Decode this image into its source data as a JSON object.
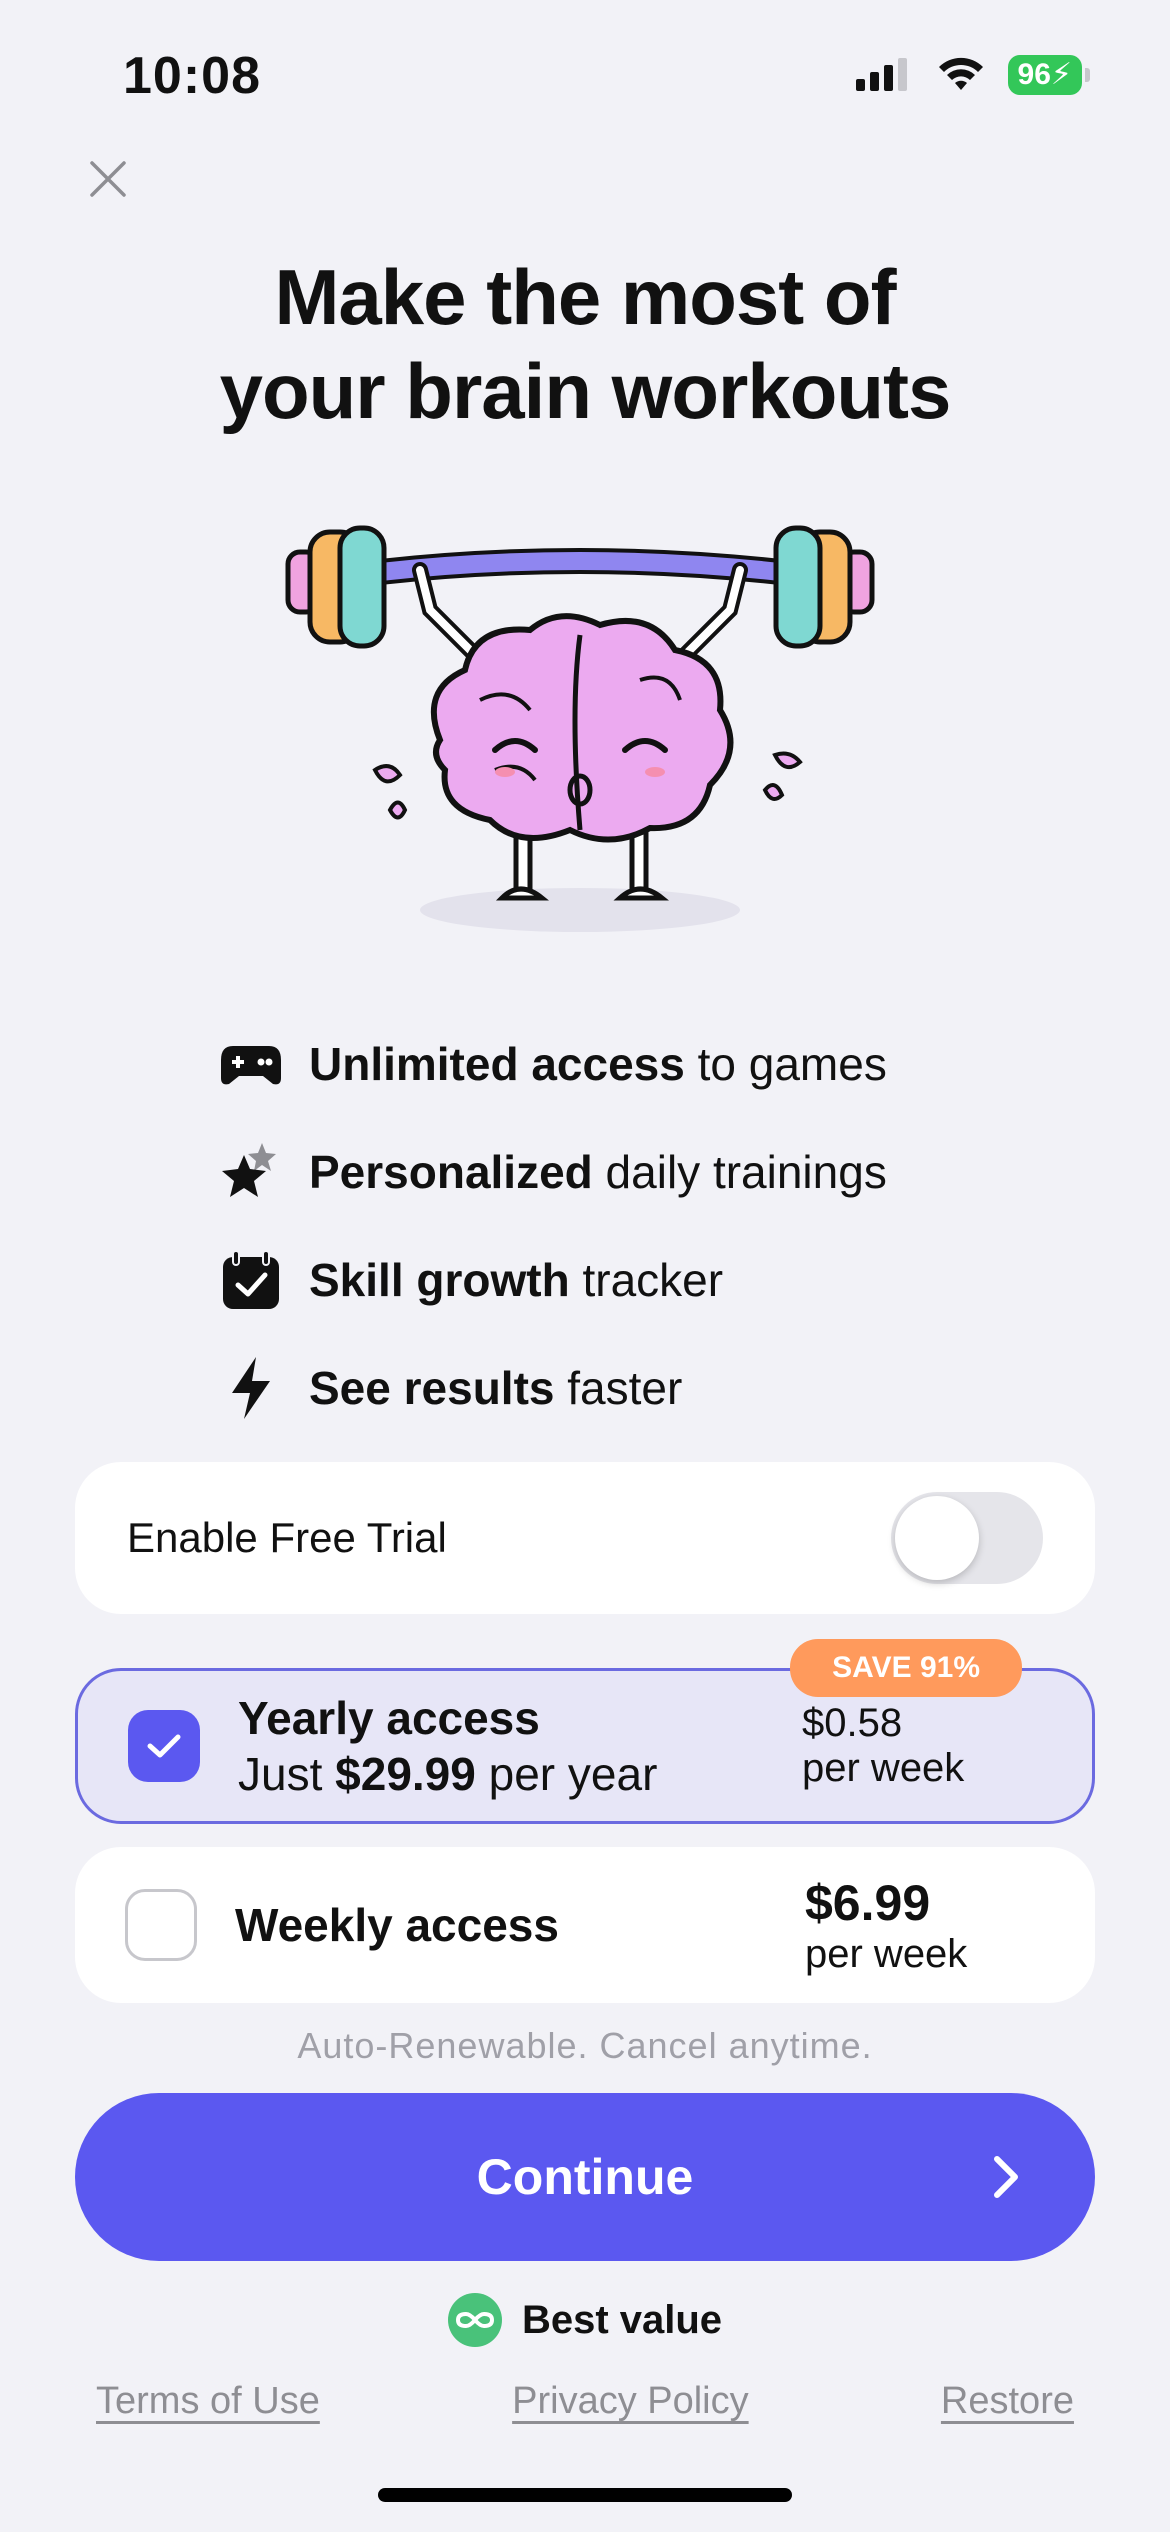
{
  "status_bar": {
    "time": "10:08",
    "battery": "96"
  },
  "title": {
    "line1": "Make the most of",
    "line2": "your brain workouts"
  },
  "features": [
    {
      "icon": "gamepad-icon",
      "bold": "Unlimited access",
      "rest": " to games"
    },
    {
      "icon": "star-icon",
      "bold": "Personalized",
      "rest": " daily trainings"
    },
    {
      "icon": "calendar-check-icon",
      "bold": "Skill growth",
      "rest": " tracker"
    },
    {
      "icon": "lightning-icon",
      "bold": "See results",
      "rest": " faster"
    }
  ],
  "trial": {
    "label": "Enable Free Trial",
    "enabled": false
  },
  "plans": {
    "yearly": {
      "name": "Yearly access",
      "sub_prefix": "Just ",
      "sub_price": "$29.99",
      "sub_suffix": " per year",
      "price_line1": "$0.58",
      "price_line2": "per week",
      "badge": "SAVE 91%",
      "selected": true
    },
    "weekly": {
      "name": "Weekly access",
      "price_line1": "$6.99",
      "price_line2": "per week",
      "selected": false
    }
  },
  "renew_note": "Auto-Renewable. Cancel anytime.",
  "cta": {
    "label": "Continue"
  },
  "best_value": "Best value",
  "links": {
    "terms": "Terms of Use",
    "privacy": "Privacy Policy",
    "restore": "Restore"
  },
  "colors": {
    "accent": "#5b58f0",
    "badge": "#ff9a5c",
    "success": "#49c27a",
    "background": "#f2f2f7"
  }
}
